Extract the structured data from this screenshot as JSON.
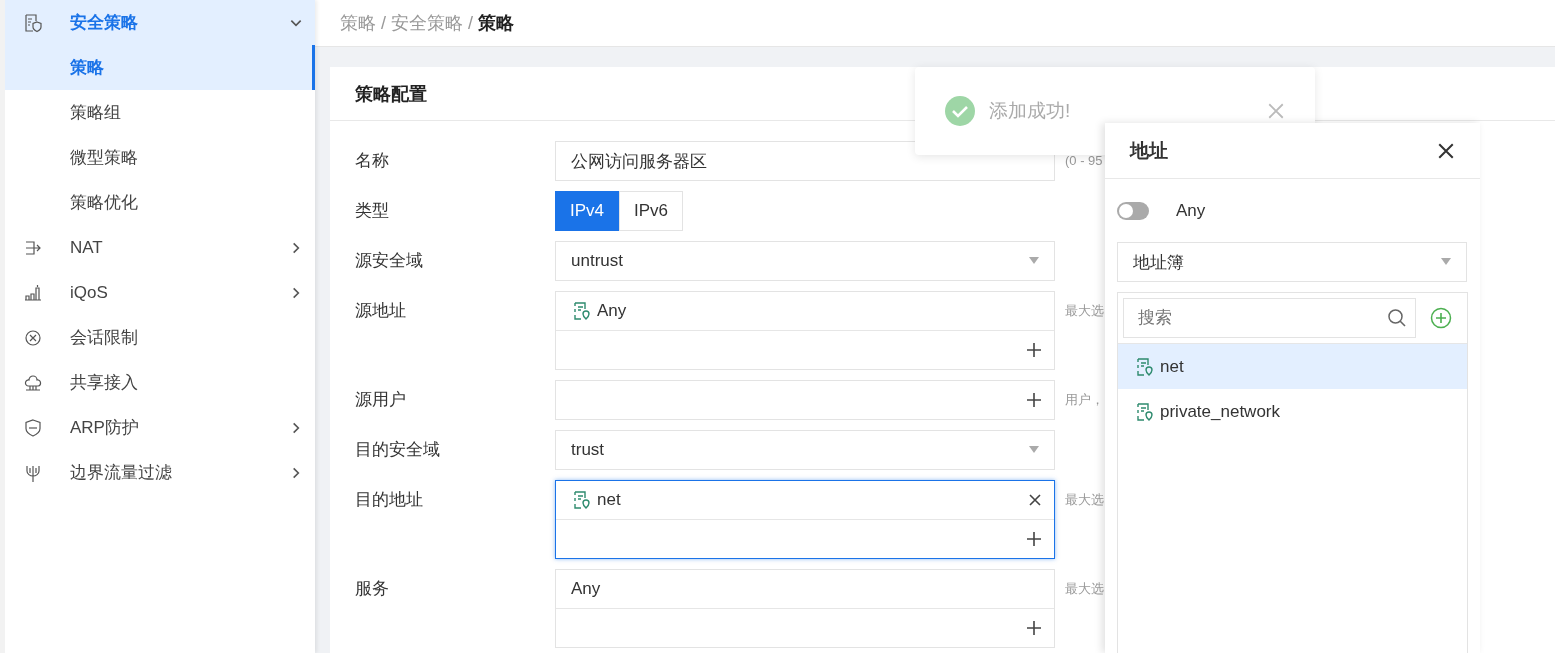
{
  "sidebar": {
    "items": [
      {
        "label": "安全策略",
        "expanded": true,
        "children": [
          {
            "label": "策略",
            "selected": true
          },
          {
            "label": "策略组",
            "selected": false
          },
          {
            "label": "微型策略",
            "selected": false
          },
          {
            "label": "策略优化",
            "selected": false
          }
        ]
      },
      {
        "label": "NAT",
        "expanded": false
      },
      {
        "label": "iQoS",
        "expanded": false
      },
      {
        "label": "会话限制"
      },
      {
        "label": "共享接入"
      },
      {
        "label": "ARP防护",
        "expanded": false
      },
      {
        "label": "边界流量过滤",
        "expanded": false
      }
    ]
  },
  "breadcrumb": "策略 / 安全策略 / **策略**",
  "card": {
    "title": "策略配置",
    "rows": [
      {
        "label": "名称",
        "kind": "text",
        "value": "公网访问服务器区",
        "hint": "(0 - 95"
      },
      {
        "label": "类型",
        "kind": "segmented",
        "options": [
          {
            "label": "IPv4",
            "selected": true
          },
          {
            "label": "IPv6",
            "selected": false
          }
        ]
      },
      {
        "label": "源安全域",
        "kind": "select",
        "value": "untrust"
      },
      {
        "label": "源地址",
        "kind": "multi",
        "focused": false,
        "items": [
          {
            "text": "Any",
            "kind": "address",
            "removable": false
          }
        ],
        "hint": "最大选"
      },
      {
        "label": "源用户",
        "kind": "multi",
        "focused": false,
        "items": [],
        "hint": "用户，"
      },
      {
        "label": "目的安全域",
        "kind": "select",
        "value": "trust"
      },
      {
        "label": "目的地址",
        "kind": "multi",
        "focused": true,
        "items": [
          {
            "text": "net",
            "kind": "address",
            "removable": true
          }
        ],
        "hint": "最大选"
      },
      {
        "label": "服务",
        "kind": "multi",
        "focused": false,
        "items": [
          {
            "text": "Any",
            "kind": "plain",
            "removable": false
          }
        ],
        "hint": "最大选"
      }
    ]
  },
  "toast": {
    "message": "添加成功!"
  },
  "panel": {
    "title": "地址",
    "toggle": {
      "label": "Any",
      "on": false
    },
    "source": "地址簿",
    "search": {
      "placeholder": "搜索"
    },
    "items": [
      {
        "label": "net",
        "selected": true
      },
      {
        "label": "private_network",
        "selected": false
      }
    ]
  }
}
